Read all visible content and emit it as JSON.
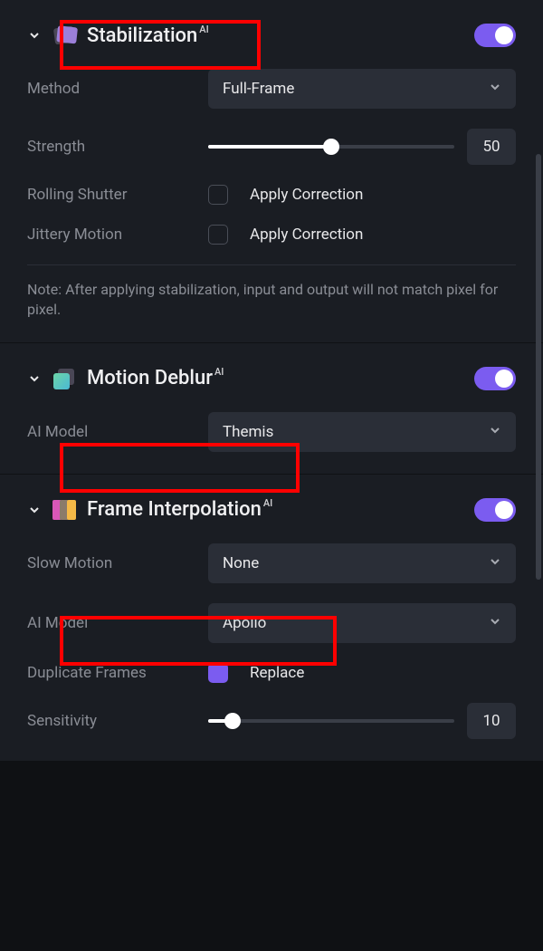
{
  "sections": {
    "stabilization": {
      "title": "Stabilization",
      "ai_badge": "AI",
      "method": {
        "label": "Method",
        "value": "Full-Frame"
      },
      "strength": {
        "label": "Strength",
        "value": "50"
      },
      "rolling_shutter": {
        "label": "Rolling Shutter",
        "checkbox_label": "Apply Correction"
      },
      "jittery_motion": {
        "label": "Jittery Motion",
        "checkbox_label": "Apply Correction"
      },
      "note": "Note: After applying stabilization, input and output will not match pixel for pixel."
    },
    "motion_deblur": {
      "title": "Motion Deblur",
      "ai_badge": "AI",
      "ai_model": {
        "label": "AI Model",
        "value": "Themis"
      }
    },
    "frame_interpolation": {
      "title": "Frame Interpolation",
      "ai_badge": "AI",
      "slow_motion": {
        "label": "Slow Motion",
        "value": "None"
      },
      "ai_model": {
        "label": "AI Model",
        "value": "Apollo"
      },
      "duplicate_frames": {
        "label": "Duplicate Frames",
        "checkbox_label": "Replace"
      },
      "sensitivity": {
        "label": "Sensitivity",
        "value": "10"
      }
    }
  }
}
